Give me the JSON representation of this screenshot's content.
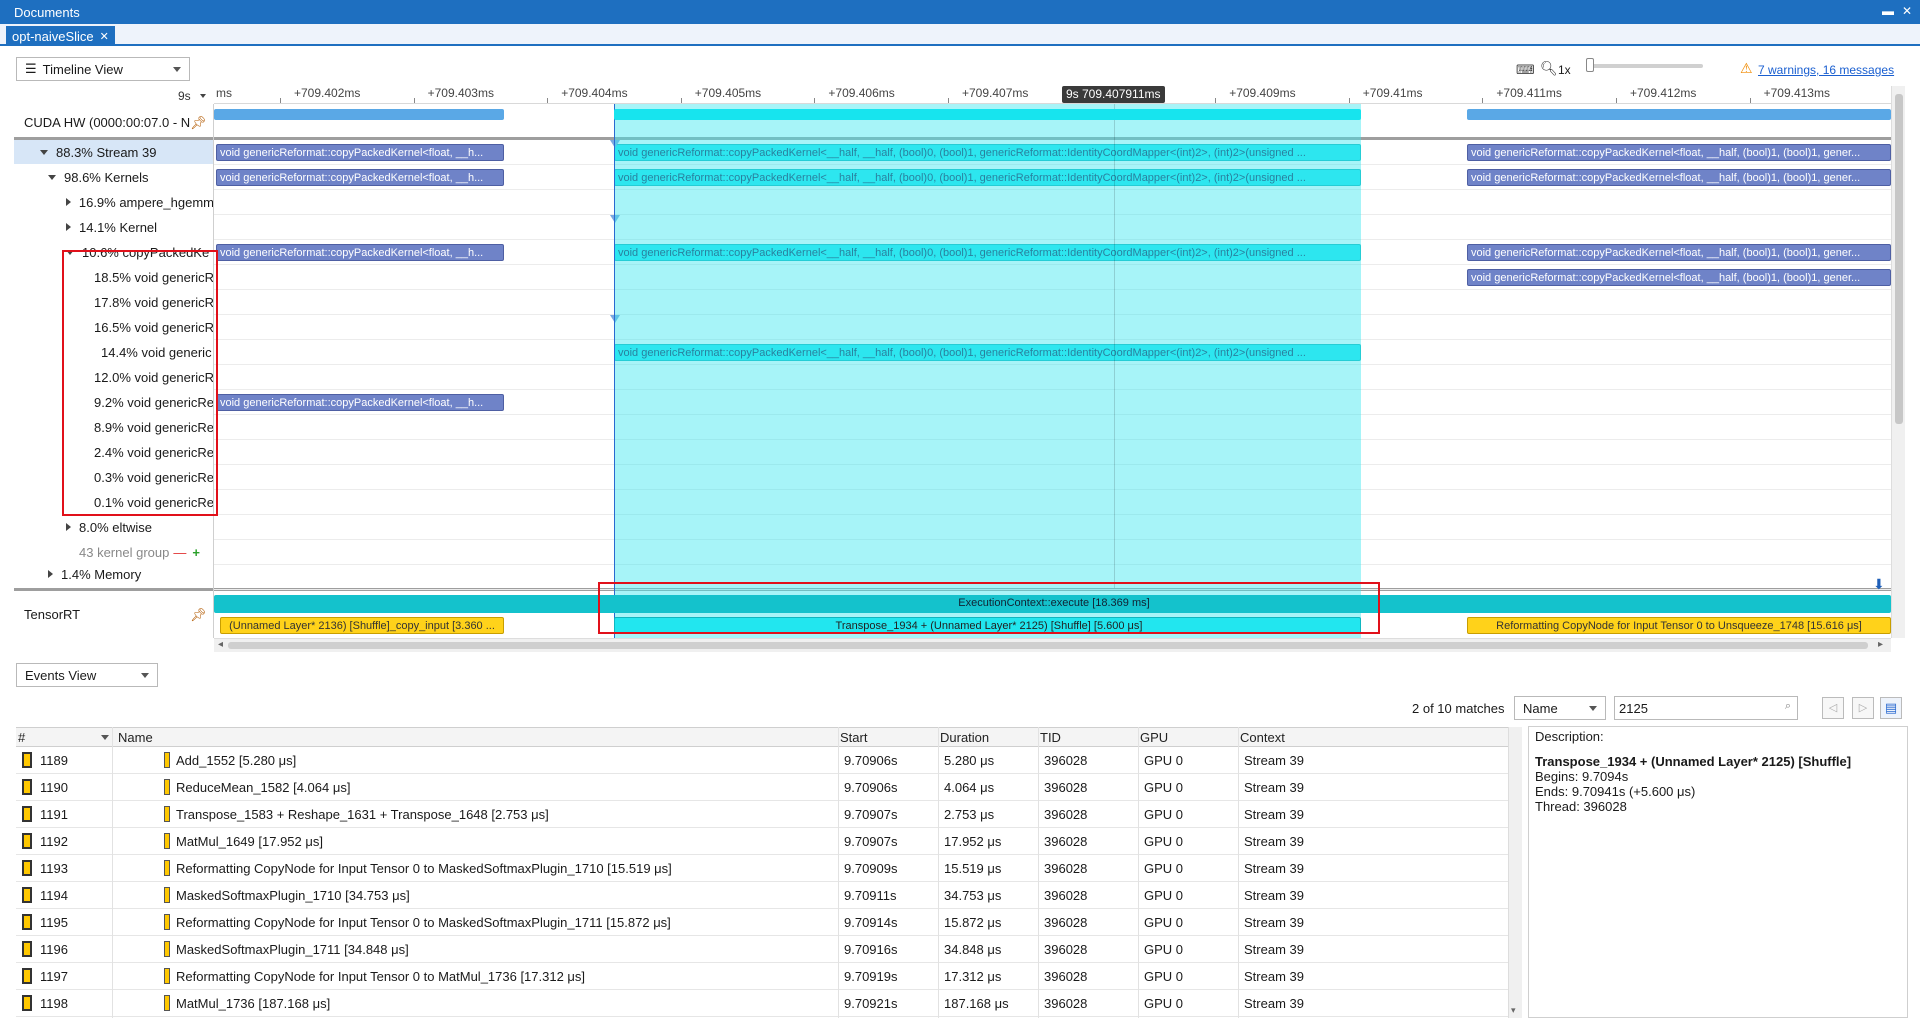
{
  "window": {
    "title": "Documents",
    "doc_tab": "opt-naiveSlice"
  },
  "toolbar": {
    "view_select": "Timeline View",
    "zoom_level": "1x",
    "warnings_link": "7 warnings, 16 messages"
  },
  "ruler": {
    "prefix": "9s",
    "first_label": "ms",
    "ticks": [
      "+709.402ms",
      "+709.403ms",
      "+709.404ms",
      "+709.405ms",
      "+709.406ms",
      "+709.407ms",
      "+709.408ms",
      "+709.409ms",
      "+709.41ms",
      "+709.411ms",
      "+709.412ms",
      "+709.413ms"
    ],
    "cursor_label": "9s 709.407911ms"
  },
  "tree": {
    "cuda_hw": "CUDA HW (0000:00:07.0 - N",
    "rows": [
      {
        "label": "88.3% Stream 39",
        "indent": 1,
        "arrow": "down"
      },
      {
        "label": "98.6% Kernels",
        "indent": 2,
        "arrow": "down"
      },
      {
        "label": "16.9% ampere_hgemm",
        "indent": 3,
        "arrow": "right"
      },
      {
        "label": "14.1% Kernel",
        "indent": 3,
        "arrow": "right"
      },
      {
        "label": "10.6% copyPackedKe",
        "indent": 3,
        "arrow": "down"
      },
      {
        "label": "18.5% void genericR",
        "indent": 4,
        "arrow": ""
      },
      {
        "label": "17.8% void genericR",
        "indent": 4,
        "arrow": ""
      },
      {
        "label": "16.5% void genericR",
        "indent": 4,
        "arrow": ""
      },
      {
        "label": "14.4% void generic",
        "indent": 4,
        "arrow": ""
      },
      {
        "label": "12.0% void genericR",
        "indent": 4,
        "arrow": ""
      },
      {
        "label": "9.2% void genericRe",
        "indent": 4,
        "arrow": ""
      },
      {
        "label": "8.9% void genericRe",
        "indent": 4,
        "arrow": ""
      },
      {
        "label": "2.4% void genericRe",
        "indent": 4,
        "arrow": ""
      },
      {
        "label": "0.3% void genericRe",
        "indent": 4,
        "arrow": ""
      },
      {
        "label": "0.1% void genericRe",
        "indent": 4,
        "arrow": ""
      },
      {
        "label": "8.0% eltwise",
        "indent": 3,
        "arrow": "right"
      },
      {
        "label": "43 kernel group",
        "indent": 3,
        "arrow": ""
      },
      {
        "label": "1.4% Memory",
        "indent": 2,
        "arrow": "right"
      }
    ],
    "tensorrt": "TensorRT"
  },
  "timeline": {
    "kernel_left": "void genericReformat::copyPackedKernel<float, __h...",
    "kernel_mid": "void genericReformat::copyPackedKernel<__half, __half, (bool)0, (bool)1, genericReformat::IdentityCoordMapper<(int)2>, (int)2>(unsigned ...",
    "kernel_right": "void genericReformat::copyPackedKernel<float, __half, (bool)1, (bool)1, gener...",
    "exec_context": "ExecutionContext::execute [18.369 ms]",
    "trt_left": "(Unnamed Layer* 2136) [Shuffle]_copy_input [3.360 ...",
    "trt_mid": "Transpose_1934 + (Unnamed Layer* 2125) [Shuffle] [5.600 μs]",
    "trt_right": "Reformatting CopyNode for Input Tensor 0 to Unsqueeze_1748 [15.616 μs]"
  },
  "events": {
    "view_select": "Events View",
    "matches": "2 of 10 matches",
    "search_field_select": "Name",
    "search_value": "2125",
    "columns": [
      "#",
      "Name",
      "Start",
      "Duration",
      "TID",
      "GPU",
      "Context"
    ],
    "rows": [
      {
        "id": "1189",
        "name": "Add_1552 [5.280 μs]",
        "start": "9.70906s",
        "duration": "5.280 μs",
        "tid": "396028",
        "gpu": "GPU 0",
        "context": "Stream 39"
      },
      {
        "id": "1190",
        "name": "ReduceMean_1582 [4.064 μs]",
        "start": "9.70906s",
        "duration": "4.064 μs",
        "tid": "396028",
        "gpu": "GPU 0",
        "context": "Stream 39"
      },
      {
        "id": "1191",
        "name": "Transpose_1583 + Reshape_1631 + Transpose_1648 [2.753 μs]",
        "start": "9.70907s",
        "duration": "2.753 μs",
        "tid": "396028",
        "gpu": "GPU 0",
        "context": "Stream 39"
      },
      {
        "id": "1192",
        "name": "MatMul_1649 [17.952 μs]",
        "start": "9.70907s",
        "duration": "17.952 μs",
        "tid": "396028",
        "gpu": "GPU 0",
        "context": "Stream 39"
      },
      {
        "id": "1193",
        "name": "Reformatting CopyNode for Input Tensor 0 to MaskedSoftmaxPlugin_1710 [15.519 μs]",
        "start": "9.70909s",
        "duration": "15.519 μs",
        "tid": "396028",
        "gpu": "GPU 0",
        "context": "Stream 39"
      },
      {
        "id": "1194",
        "name": "MaskedSoftmaxPlugin_1710 [34.753 μs]",
        "start": "9.70911s",
        "duration": "34.753 μs",
        "tid": "396028",
        "gpu": "GPU 0",
        "context": "Stream 39"
      },
      {
        "id": "1195",
        "name": "Reformatting CopyNode for Input Tensor 0 to MaskedSoftmaxPlugin_1711 [15.872 μs]",
        "start": "9.70914s",
        "duration": "15.872 μs",
        "tid": "396028",
        "gpu": "GPU 0",
        "context": "Stream 39"
      },
      {
        "id": "1196",
        "name": "MaskedSoftmaxPlugin_1711 [34.848 μs]",
        "start": "9.70916s",
        "duration": "34.848 μs",
        "tid": "396028",
        "gpu": "GPU 0",
        "context": "Stream 39"
      },
      {
        "id": "1197",
        "name": "Reformatting CopyNode for Input Tensor 0 to MatMul_1736 [17.312 μs]",
        "start": "9.70919s",
        "duration": "17.312 μs",
        "tid": "396028",
        "gpu": "GPU 0",
        "context": "Stream 39"
      },
      {
        "id": "1198",
        "name": "MatMul_1736 [187.168 μs]",
        "start": "9.70921s",
        "duration": "187.168 μs",
        "tid": "396028",
        "gpu": "GPU 0",
        "context": "Stream 39"
      }
    ]
  },
  "description": {
    "label": "Description:",
    "title": "Transpose_1934 + (Unnamed Layer* 2125) [Shuffle]",
    "begins": "Begins: 9.7094s",
    "ends": "Ends: 9.70941s (+5.600 μs)",
    "thread": "Thread: 396028"
  },
  "colors": {
    "accent": "#1e6fc0",
    "kernel": "#6f83c8",
    "selected": "#22e6ef",
    "nvtx": "#ffd21a",
    "highlight_box": "#e1101a"
  }
}
